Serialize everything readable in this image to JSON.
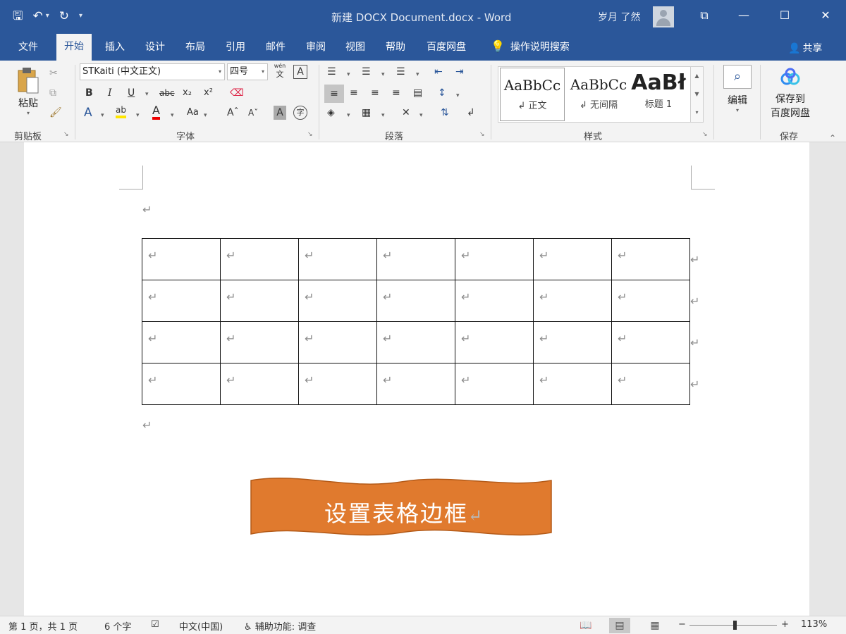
{
  "titlebar": {
    "doc_title": "新建 DOCX Document.docx  -  Word",
    "user": "岁月 了然",
    "qat": {
      "save": "🖫",
      "undo": "↶",
      "undo_dd": "▾",
      "redo": "↻",
      "customize": "▾"
    },
    "controls": {
      "ribbon_display": "⧉",
      "minimize": "—",
      "maximize": "☐",
      "close": "✕"
    }
  },
  "tabs": [
    "文件",
    "开始",
    "插入",
    "设计",
    "布局",
    "引用",
    "邮件",
    "审阅",
    "视图",
    "帮助",
    "百度网盘"
  ],
  "tell_me": "操作说明搜索",
  "share": "共享",
  "ribbon": {
    "clipboard": {
      "paste": "粘贴",
      "label": "剪贴板"
    },
    "font": {
      "name": "STKaiti (中文正文)",
      "size": "四号",
      "label": "字体",
      "bold": "B",
      "italic": "I",
      "underline": "U",
      "strike": "abc",
      "sub": "x₂",
      "sup": "x²",
      "text_effects": "A",
      "highlight": "ab",
      "font_color": "A",
      "change_case": "Aa",
      "grow": "Aˆ",
      "shrink": "Aˇ",
      "char_shading": "A",
      "enclose": "字",
      "phonetic": "wén",
      "border": "A"
    },
    "paragraph": {
      "label": "段落"
    },
    "styles": {
      "label": "样式",
      "items": [
        {
          "sample": "AaBbCc",
          "name": "↲ 正文"
        },
        {
          "sample": "AaBbCc",
          "name": "↲ 无间隔"
        },
        {
          "sample": "AaBł",
          "name": "标题 1"
        }
      ]
    },
    "editing": {
      "label": "编辑"
    },
    "save": {
      "line1": "保存到",
      "line2": "百度网盘",
      "label": "保存"
    }
  },
  "document": {
    "para_mark": "↵",
    "table": {
      "rows": 4,
      "cols": 7
    },
    "banner_text": "设置表格边框"
  },
  "colors": {
    "word_blue": "#2b579a",
    "banner_orange": "#e07a2e"
  },
  "status": {
    "page": "第 1 页，共 1 页",
    "words": "6 个字",
    "lang": "中文(中国)",
    "accessibility": "辅助功能: 调查",
    "zoom_minus": "−",
    "zoom_plus": "+",
    "zoom": "113%"
  }
}
